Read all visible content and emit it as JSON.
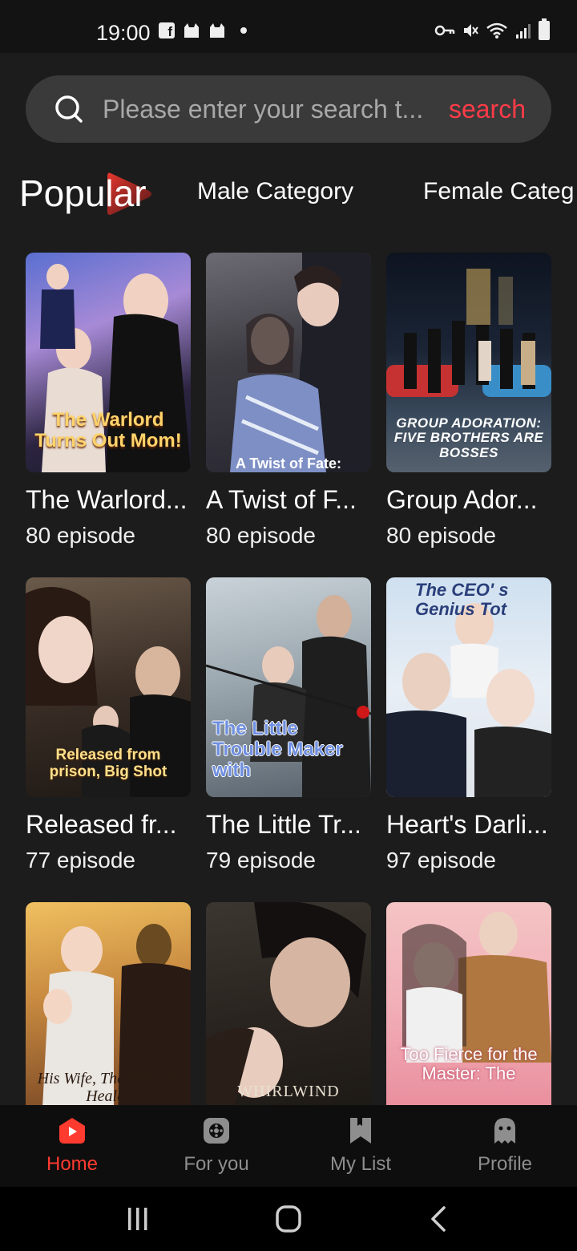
{
  "status_bar": {
    "time": "19:00"
  },
  "search": {
    "placeholder": "Please enter your search t...",
    "button_label": "search"
  },
  "tabs": [
    {
      "label": "Popular",
      "active": true
    },
    {
      "label": "Male Category",
      "active": false
    },
    {
      "label": "Female Categ",
      "active": false
    }
  ],
  "dramas": [
    {
      "title": "The Warlord...",
      "episodes": "80 episode",
      "poster_text": "The Warlord Turns Out Mom!"
    },
    {
      "title": "A Twist of F...",
      "episodes": "80 episode",
      "poster_text": "A Twist of Fate:"
    },
    {
      "title": "Group Ador...",
      "episodes": "80 episode",
      "poster_text": "GROUP ADORATION: FIVE BROTHERS ARE BOSSES"
    },
    {
      "title": "Released fr...",
      "episodes": "77 episode",
      "poster_text": "Released from prison, Big Shot"
    },
    {
      "title": "The Little Tr...",
      "episodes": "79 episode",
      "poster_text": "The Little Trouble Maker with"
    },
    {
      "title": "Heart's Darli...",
      "episodes": "97 episode",
      "poster_text": "The CEO' s Genius Tot"
    },
    {
      "title": "",
      "episodes": "",
      "poster_text": "His Wife, The Miracle Healer"
    },
    {
      "title": "",
      "episodes": "",
      "poster_text": "WHIRLWIND"
    },
    {
      "title": "",
      "episodes": "",
      "poster_text": "Too Fierce for the Master: The"
    }
  ],
  "nav": {
    "home": "Home",
    "for_you": "For you",
    "my_list": "My List",
    "profile": "Profile"
  },
  "colors": {
    "accent": "#ff3b30",
    "search_accent": "#ff3b48",
    "background": "#1c1c1c"
  }
}
